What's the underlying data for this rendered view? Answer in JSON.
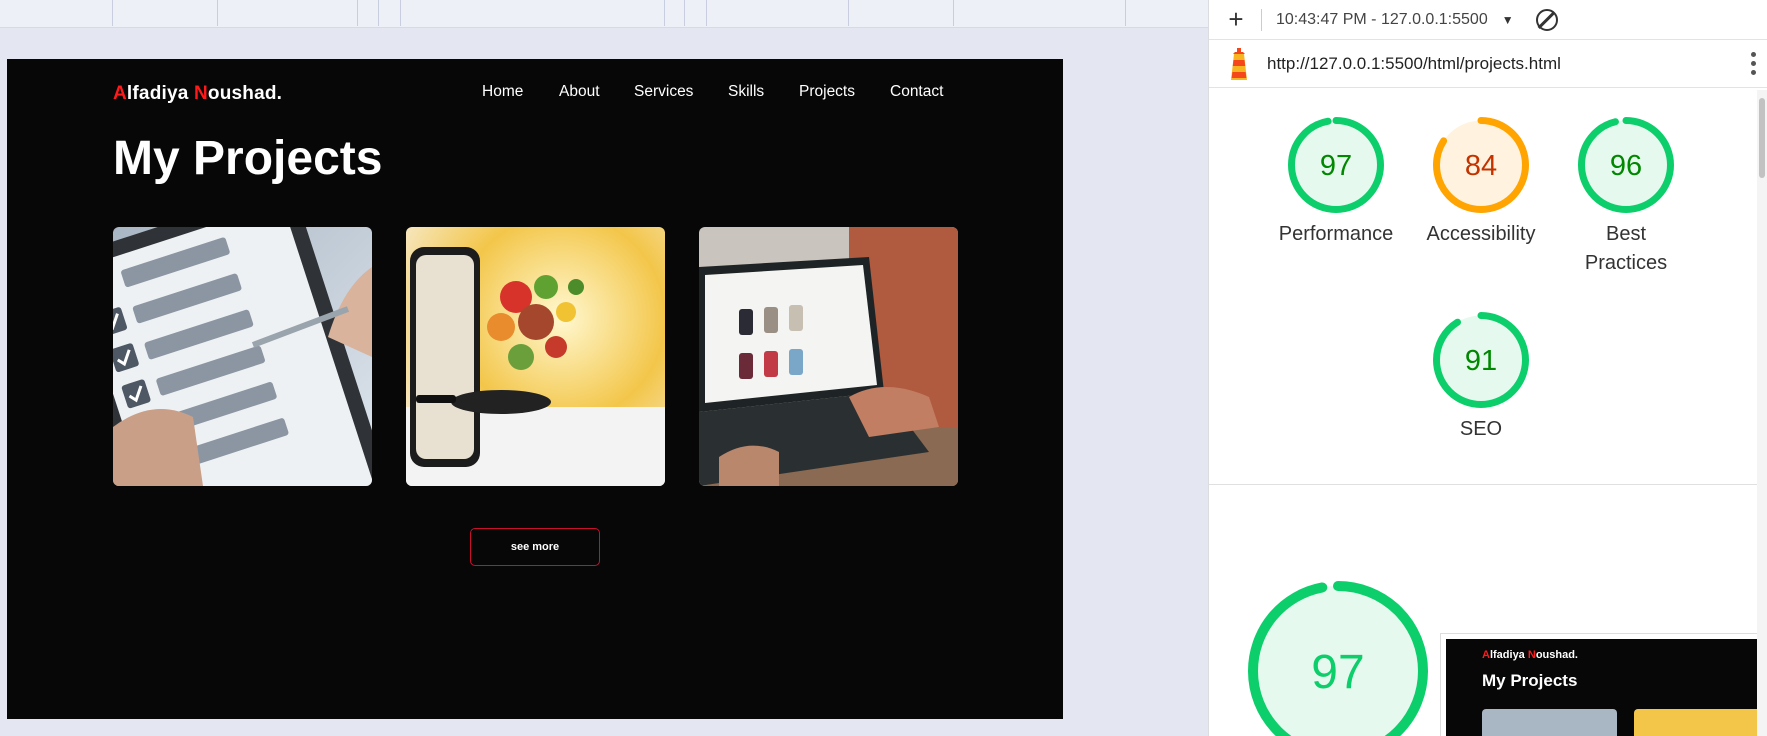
{
  "site": {
    "logo": {
      "first_initial": "A",
      "first_rest": "lfadiya ",
      "last_initial": "N",
      "last_rest": "oushad."
    },
    "nav": [
      "Home",
      "About",
      "Services",
      "Skills",
      "Projects",
      "Contact"
    ],
    "title": "My Projects",
    "projects": [
      {
        "image": "tablet-checklist-photo"
      },
      {
        "image": "phone-food-pan-photo"
      },
      {
        "image": "laptop-fashion-store-photo"
      }
    ],
    "see_more_label": "see more"
  },
  "devtools": {
    "timestamp_host": "10:43:47 PM - 127.0.0.1:5500",
    "url": "http://127.0.0.1:5500/html/projects.html",
    "scores": [
      {
        "value": "97",
        "label": "Performance",
        "level": 0.97,
        "color": "#0cce6b",
        "text_color": "#008800",
        "fill": "#e6f9ee"
      },
      {
        "value": "84",
        "label": "Accessibility",
        "level": 0.84,
        "color": "#ffa400",
        "text_color": "#c33300",
        "fill": "#fff3e0"
      },
      {
        "value": "96",
        "label": "Best Practices",
        "level": 0.96,
        "color": "#0cce6b",
        "text_color": "#008800",
        "fill": "#e6f9ee"
      },
      {
        "value": "91",
        "label": "SEO",
        "level": 0.91,
        "color": "#0cce6b",
        "text_color": "#008800",
        "fill": "#e6f9ee"
      }
    ],
    "big_score": {
      "value": "97",
      "level": 0.97,
      "color": "#0cce6b",
      "text_color": "#0cce6b",
      "fill": "#e6f9ee"
    },
    "thumbnail": {
      "logo": {
        "first_initial": "A",
        "first_rest": "lfadiya ",
        "last_initial": "N",
        "last_rest": "oushad."
      },
      "title": "My Projects"
    }
  },
  "colors": {
    "accent_red": "#ff1a1a",
    "button_border": "#c8102e",
    "pass_green": "#0cce6b",
    "average_orange": "#ffa400"
  }
}
